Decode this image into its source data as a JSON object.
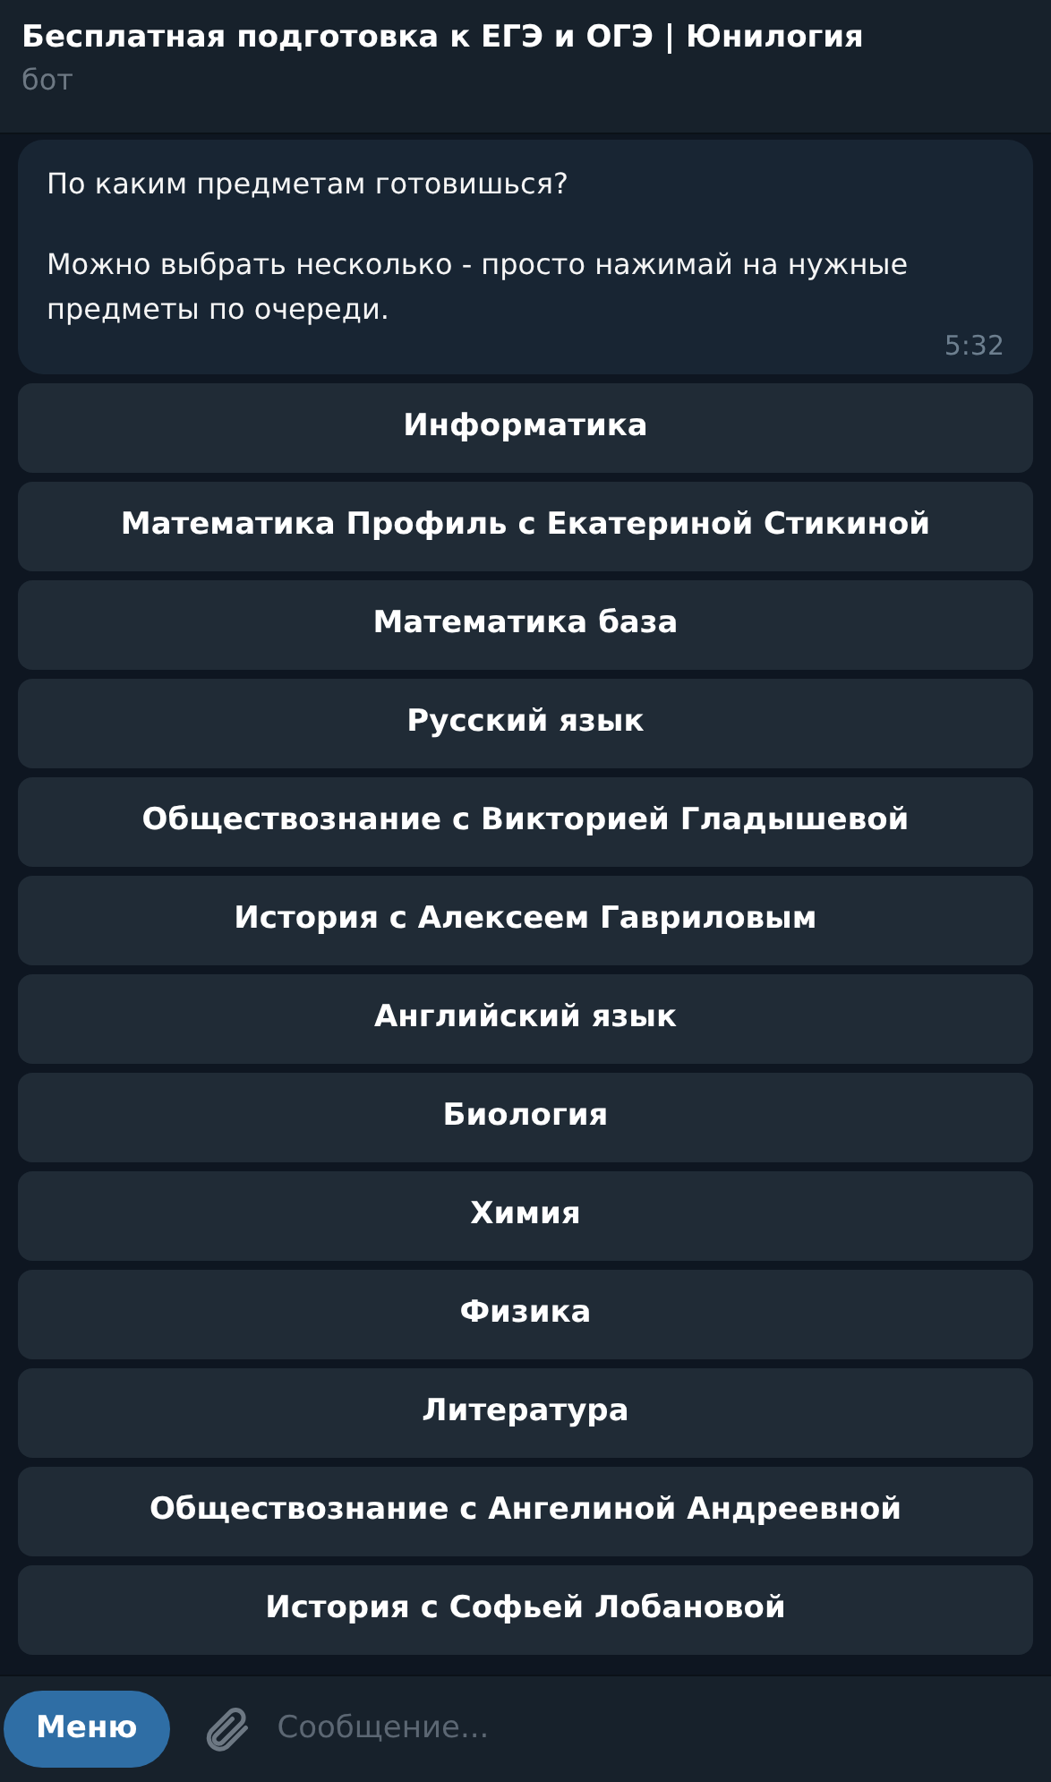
{
  "header": {
    "title": "Бесплатная подготовка к ЕГЭ и ОГЭ | Юнилогия",
    "subtitle": "бот"
  },
  "message": {
    "paragraphs": [
      "По каким предметам готовишься?",
      "Можно выбрать несколько - просто нажимай на нужные предметы по очереди."
    ],
    "time": "5:32"
  },
  "keyboard": [
    "Информатика",
    "Математика Профиль с Екатериной Стикиной",
    "Математика база",
    "Русский язык",
    "Обществознание с Викторией Гладышевой",
    "История с Алексеем Гавриловым",
    "Английский язык",
    "Биология",
    "Химия",
    "Физика",
    "Литература",
    "Обществознание с Ангелиной Андреевной",
    "История с Софьей Лобановой"
  ],
  "composer": {
    "menu_button": "Меню",
    "placeholder": "Сообщение..."
  }
}
